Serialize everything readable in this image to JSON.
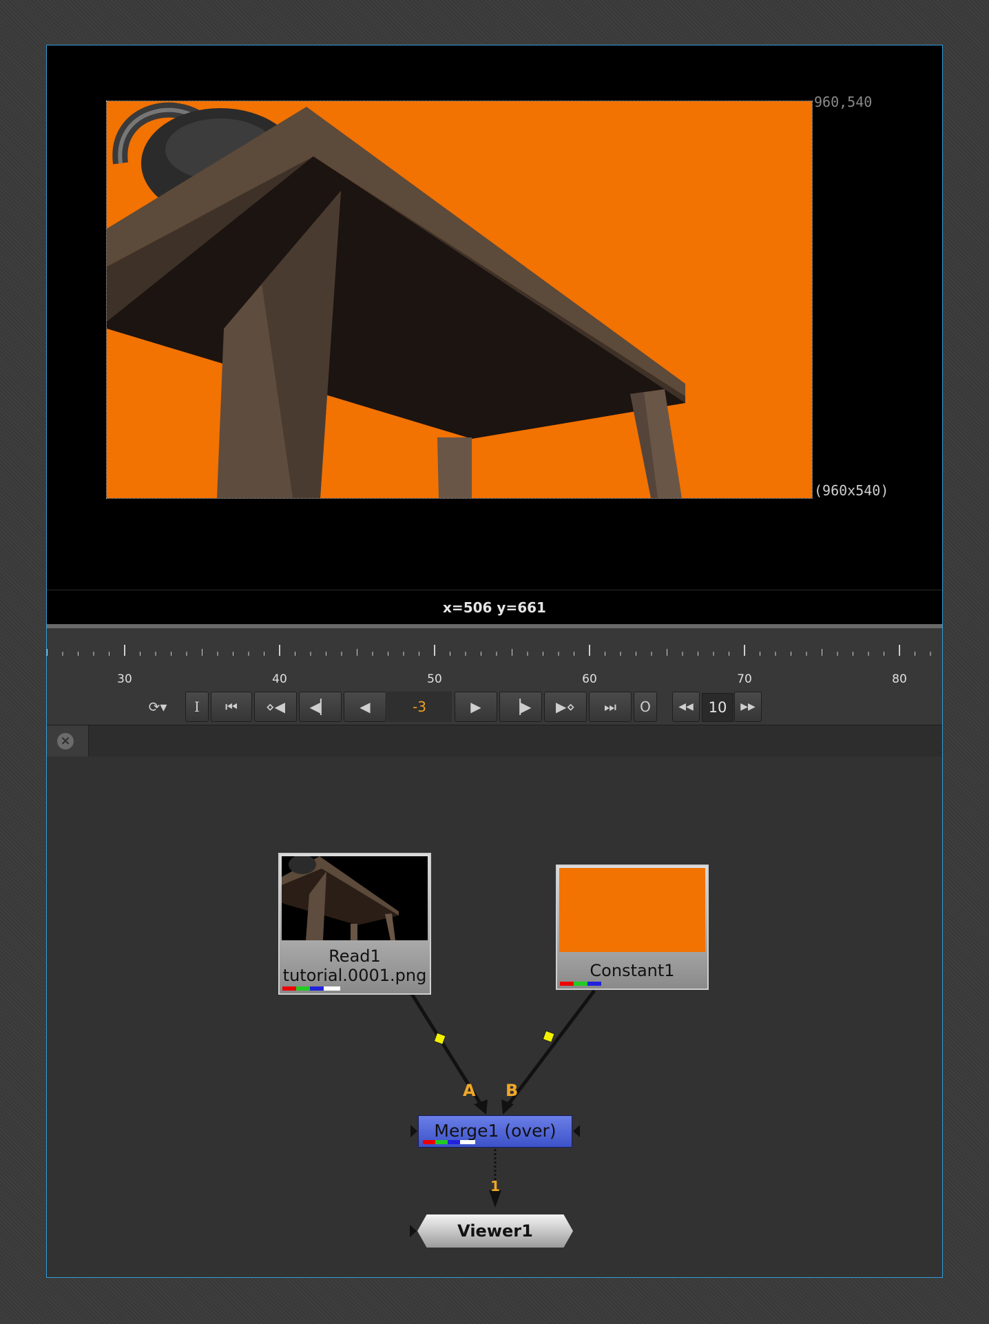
{
  "viewer": {
    "format_top_right": "960,540",
    "format_bottom_right": "(960x540)",
    "cursor_readout": "x=506 y=661",
    "background_color": "#f27202"
  },
  "timeline": {
    "ticks": [
      "30",
      "40",
      "50",
      "60",
      "70",
      "80"
    ],
    "current_frame": "-3",
    "in_label": "I",
    "out_label": "O",
    "step_value": "10",
    "icons": [
      "loop-mode-icon",
      "first-frame-icon",
      "prev-keyframe-icon",
      "step-back-icon",
      "play-backward-icon",
      "play-forward-icon",
      "step-forward-icon",
      "next-keyframe-icon",
      "last-frame-icon",
      "rewind-increment-icon",
      "forward-increment-icon"
    ]
  },
  "node_graph": {
    "nodes": {
      "read": {
        "name": "Read1",
        "file": "tutorial.0001.png"
      },
      "constant": {
        "name": "Constant1",
        "color": "#f27202"
      },
      "merge": {
        "name": "Merge1 (over)",
        "color": "#4a5fd8"
      },
      "viewer": {
        "name": "Viewer1"
      }
    },
    "inputs": {
      "a": "A",
      "b": "B",
      "viewer_input": "1"
    },
    "wire_marker_color": "#ffff00"
  }
}
